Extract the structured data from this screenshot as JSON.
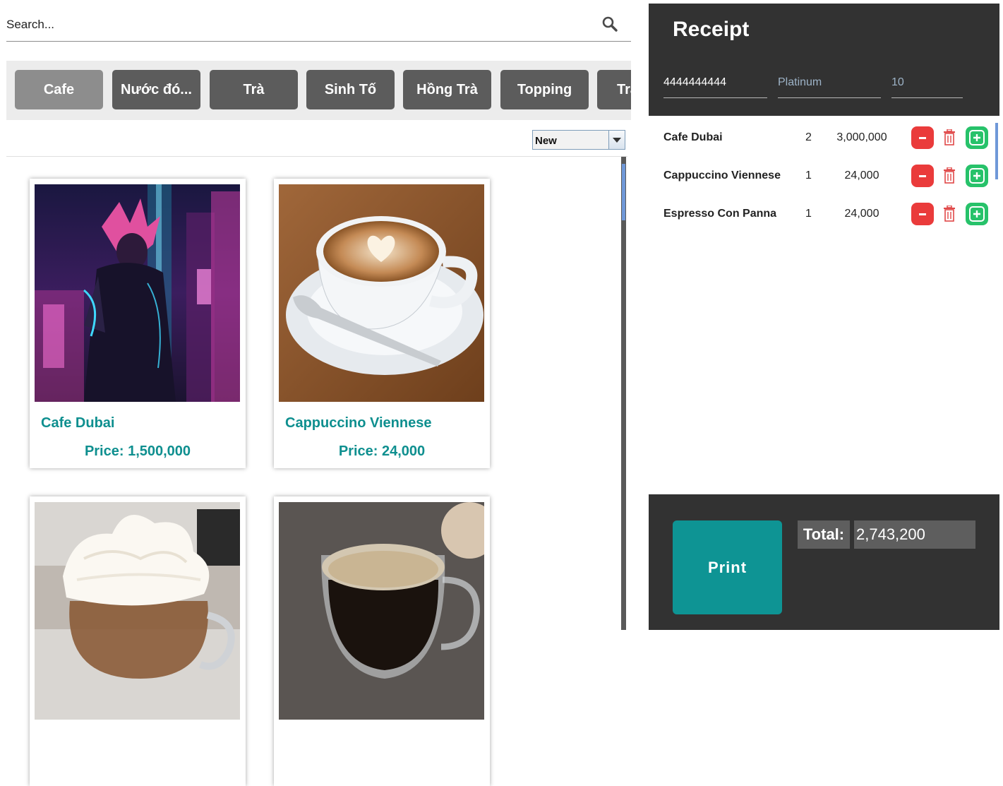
{
  "search": {
    "placeholder": "Search..."
  },
  "categories": [
    {
      "label": "Cafe",
      "active": true
    },
    {
      "label": "Nước đó..."
    },
    {
      "label": "Trà"
    },
    {
      "label": "Sinh Tố"
    },
    {
      "label": "Hồng Trà"
    },
    {
      "label": "Topping"
    },
    {
      "label": "Trà"
    }
  ],
  "sort": {
    "selected": "New"
  },
  "products": [
    {
      "name": "Cafe Dubai",
      "price": "Price: 1,500,000"
    },
    {
      "name": "Cappuccino Viennese",
      "price": "Price: 24,000"
    }
  ],
  "receipt": {
    "title": "Receipt",
    "customer": {
      "phone": "4444444444",
      "tier": "Platinum",
      "discount": "10"
    },
    "items": [
      {
        "name": "Cafe Dubai",
        "qty": "2",
        "price": "3,000,000"
      },
      {
        "name": "Cappuccino Viennese",
        "qty": "1",
        "price": "24,000"
      },
      {
        "name": "Espresso Con Panna",
        "qty": "1",
        "price": "24,000"
      }
    ],
    "print_label": "Print",
    "total_label": "Total:",
    "total_value": "2,743,200"
  },
  "colors": {
    "accent": "#0e9494",
    "panel_dark": "#323232",
    "minus": "#ea3b3b",
    "plus": "#27c26a"
  },
  "icons": {
    "search": "search-icon",
    "trash": "trash-icon",
    "minus": "minus-icon",
    "plus": "add-icon"
  }
}
